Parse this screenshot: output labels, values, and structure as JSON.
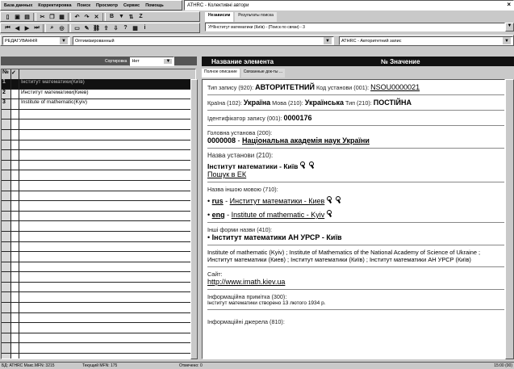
{
  "menu": [
    "База данных",
    "Корректировка",
    "Поиск",
    "Просмотр",
    "Сервис",
    "Помощь"
  ],
  "window_title": "ATHRC - Колективні автори",
  "toolbar": {
    "row1_icons": [
      "new-icon",
      "save-icon",
      "print-icon",
      "cut-icon",
      "copy-icon",
      "paste-icon",
      "undo-icon",
      "redo-icon",
      "delete-icon",
      "bold-icon",
      "filter-icon",
      "sort-icon",
      "zoom-icon"
    ],
    "row2_icons": [
      "first-icon",
      "prev-icon",
      "next-icon",
      "last-icon",
      "search-icon",
      "find-icon",
      "view-icon",
      "edit-icon",
      "link-icon",
      "export-icon",
      "import-icon",
      "help-icon",
      "grid-icon",
      "info-icon",
      "tree-icon"
    ]
  },
  "query": {
    "tabs": [
      "Независим",
      "Результаты поиска"
    ],
    "active_tab": 0,
    "field": "УНІінститут математики (Київ) - (Поиск по связи) - 3"
  },
  "mode": {
    "edit_mode": "РЕДАГУВАННЯ",
    "optimization": "Оптимізированный",
    "db_name": "ATHRC - Авторитетний запис"
  },
  "left": {
    "sort_label": "Сортировка",
    "sort_value": "Нет",
    "col_num": "№",
    "col_check": "✓",
    "rows": [
      {
        "n": "1",
        "text": "Інститут математики(Київ)",
        "selected": true
      },
      {
        "n": "2",
        "text": "Институт математики(Киев)",
        "selected": false
      },
      {
        "n": "3",
        "text": "Institute of mathematic(Kyiv)",
        "selected": false
      },
      {
        "n": "",
        "text": ""
      },
      {
        "n": "",
        "text": ""
      },
      {
        "n": "",
        "text": ""
      },
      {
        "n": "",
        "text": ""
      },
      {
        "n": "",
        "text": ""
      },
      {
        "n": "",
        "text": ""
      },
      {
        "n": "",
        "text": ""
      },
      {
        "n": "",
        "text": ""
      },
      {
        "n": "",
        "text": ""
      },
      {
        "n": "",
        "text": ""
      },
      {
        "n": "",
        "text": ""
      },
      {
        "n": "",
        "text": ""
      },
      {
        "n": "",
        "text": ""
      },
      {
        "n": "",
        "text": ""
      },
      {
        "n": "",
        "text": ""
      },
      {
        "n": "",
        "text": ""
      },
      {
        "n": "",
        "text": ""
      },
      {
        "n": "",
        "text": ""
      },
      {
        "n": "",
        "text": ""
      },
      {
        "n": "",
        "text": ""
      },
      {
        "n": "",
        "text": ""
      },
      {
        "n": "",
        "text": ""
      },
      {
        "n": "",
        "text": ""
      },
      {
        "n": "",
        "text": ""
      },
      {
        "n": "",
        "text": ""
      },
      {
        "n": "",
        "text": ""
      }
    ]
  },
  "right": {
    "col_name": "Название элемента",
    "col_num_value": "№ Значение",
    "tabs": [
      "Полное описание",
      "Связанные док-ты ..."
    ],
    "record": {
      "type_lbl": "Тип запису (920): ",
      "type_val": "АВТОРИТЕТНИЙ",
      "code_lbl": " Код установи (001): ",
      "code_val": "NSOU0000021",
      "country_lbl": "Країна (102): ",
      "country_val": "Україна",
      "lang_lbl": "  Мова (210): ",
      "lang_val": "Українська",
      "type2_lbl": "  Тип (210): ",
      "type2_val": "ПОСТІЙНА",
      "ident_lbl": "Ідентифікатор запису (001): ",
      "ident_val": "0000176",
      "parent_lbl": "Головна установа (200):",
      "parent_code": "0000008",
      "parent_name": "Національна академія наук України",
      "name_lbl": "Назва установи (210):",
      "name_val": "Інститут математики - Київ",
      "search_link": "Пошук в ЕК",
      "other_lang_lbl": "Назва іншою мовою (710):",
      "rus_code": "rus",
      "rus_val": "Институт математики - Киев",
      "eng_code": "eng",
      "eng_val": "Institute of mathematic - Kyiv",
      "other_forms_lbl": "Інші форми назви (410):",
      "other_forms_val": "Інститут математики АН УРСР - Київ",
      "full_desc": "Institute of mathematic (Kyiv) ; Institute of Mathematics of the National Academy of Science of Ukraine ; Институт математики (Киев) ; Інститут математики (Київ) ; Інститут математики АН УРСР (Київ)",
      "site_lbl": "Сайт:",
      "site_val": "http://www.imath.kiev.ua",
      "note_lbl": "Інформаційна примітка (300):",
      "note_val": "Інститут математики створено 13 лютого 1934 р.",
      "sources_lbl": "Інформаційні джерела (810):"
    }
  },
  "status": {
    "db": "БД: ATHRC Макс.MFN: 3215",
    "current": "Текущий MFN: 175",
    "marked": "Отмечено: 0",
    "time": "15:00 (00)"
  }
}
